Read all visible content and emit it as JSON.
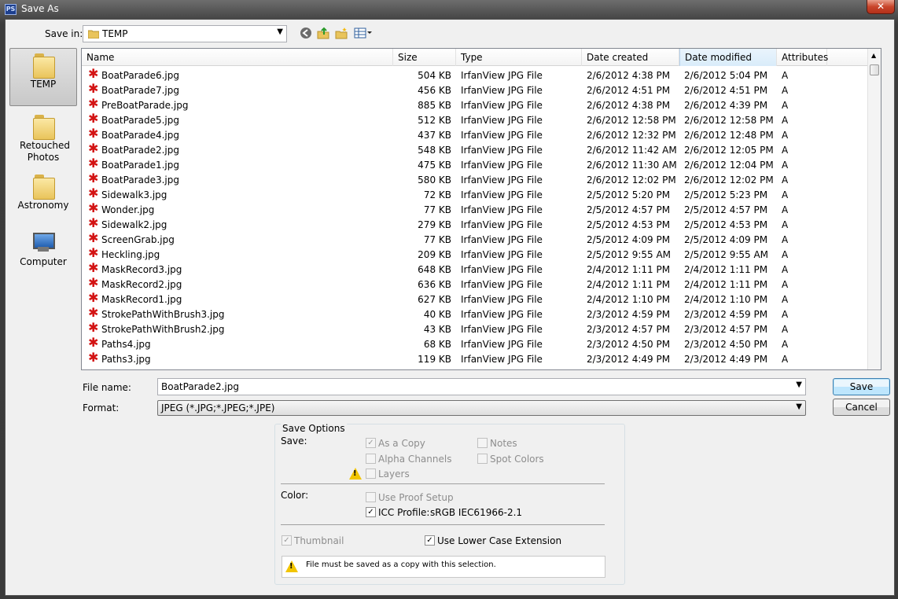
{
  "window": {
    "title": "Save As",
    "app_icon": "PS",
    "close_glyph": "✕"
  },
  "savein": {
    "label": "Save in:",
    "value": "TEMP"
  },
  "toolbar": {
    "back": "◄",
    "up": "↑",
    "new_folder": "✦",
    "views": "▦▾"
  },
  "places": [
    {
      "label": "TEMP",
      "icon": "folder-icon",
      "selected": true
    },
    {
      "label": "Retouched Photos",
      "icon": "folder-icon"
    },
    {
      "label": "Astronomy",
      "icon": "folder-icon"
    },
    {
      "label": "Computer",
      "icon": "computer-icon"
    }
  ],
  "columns": [
    "Name",
    "Size",
    "Type",
    "Date created",
    "Date modified",
    "Attributes"
  ],
  "files": [
    {
      "name": "BoatParade6.jpg",
      "size": "504 KB",
      "type": "IrfanView JPG File",
      "created": "2/6/2012 4:38 PM",
      "modified": "2/6/2012 5:04 PM",
      "attr": "A"
    },
    {
      "name": "BoatParade7.jpg",
      "size": "456 KB",
      "type": "IrfanView JPG File",
      "created": "2/6/2012 4:51 PM",
      "modified": "2/6/2012 4:51 PM",
      "attr": "A"
    },
    {
      "name": "PreBoatParade.jpg",
      "size": "885 KB",
      "type": "IrfanView JPG File",
      "created": "2/6/2012 4:38 PM",
      "modified": "2/6/2012 4:39 PM",
      "attr": "A"
    },
    {
      "name": "BoatParade5.jpg",
      "size": "512 KB",
      "type": "IrfanView JPG File",
      "created": "2/6/2012 12:58 PM",
      "modified": "2/6/2012 12:58 PM",
      "attr": "A"
    },
    {
      "name": "BoatParade4.jpg",
      "size": "437 KB",
      "type": "IrfanView JPG File",
      "created": "2/6/2012 12:32 PM",
      "modified": "2/6/2012 12:48 PM",
      "attr": "A"
    },
    {
      "name": "BoatParade2.jpg",
      "size": "548 KB",
      "type": "IrfanView JPG File",
      "created": "2/6/2012 11:42 AM",
      "modified": "2/6/2012 12:05 PM",
      "attr": "A"
    },
    {
      "name": "BoatParade1.jpg",
      "size": "475 KB",
      "type": "IrfanView JPG File",
      "created": "2/6/2012 11:30 AM",
      "modified": "2/6/2012 12:04 PM",
      "attr": "A"
    },
    {
      "name": "BoatParade3.jpg",
      "size": "580 KB",
      "type": "IrfanView JPG File",
      "created": "2/6/2012 12:02 PM",
      "modified": "2/6/2012 12:02 PM",
      "attr": "A"
    },
    {
      "name": "Sidewalk3.jpg",
      "size": "72 KB",
      "type": "IrfanView JPG File",
      "created": "2/5/2012 5:20 PM",
      "modified": "2/5/2012 5:23 PM",
      "attr": "A"
    },
    {
      "name": "Wonder.jpg",
      "size": "77 KB",
      "type": "IrfanView JPG File",
      "created": "2/5/2012 4:57 PM",
      "modified": "2/5/2012 4:57 PM",
      "attr": "A"
    },
    {
      "name": "Sidewalk2.jpg",
      "size": "279 KB",
      "type": "IrfanView JPG File",
      "created": "2/5/2012 4:53 PM",
      "modified": "2/5/2012 4:53 PM",
      "attr": "A"
    },
    {
      "name": "ScreenGrab.jpg",
      "size": "77 KB",
      "type": "IrfanView JPG File",
      "created": "2/5/2012 4:09 PM",
      "modified": "2/5/2012 4:09 PM",
      "attr": "A"
    },
    {
      "name": "Heckling.jpg",
      "size": "209 KB",
      "type": "IrfanView JPG File",
      "created": "2/5/2012 9:55 AM",
      "modified": "2/5/2012 9:55 AM",
      "attr": "A"
    },
    {
      "name": "MaskRecord3.jpg",
      "size": "648 KB",
      "type": "IrfanView JPG File",
      "created": "2/4/2012 1:11 PM",
      "modified": "2/4/2012 1:11 PM",
      "attr": "A"
    },
    {
      "name": "MaskRecord2.jpg",
      "size": "636 KB",
      "type": "IrfanView JPG File",
      "created": "2/4/2012 1:11 PM",
      "modified": "2/4/2012 1:11 PM",
      "attr": "A"
    },
    {
      "name": "MaskRecord1.jpg",
      "size": "627 KB",
      "type": "IrfanView JPG File",
      "created": "2/4/2012 1:10 PM",
      "modified": "2/4/2012 1:10 PM",
      "attr": "A"
    },
    {
      "name": "StrokePathWithBrush3.jpg",
      "size": "40 KB",
      "type": "IrfanView JPG File",
      "created": "2/3/2012 4:59 PM",
      "modified": "2/3/2012 4:59 PM",
      "attr": "A"
    },
    {
      "name": "StrokePathWithBrush2.jpg",
      "size": "43 KB",
      "type": "IrfanView JPG File",
      "created": "2/3/2012 4:57 PM",
      "modified": "2/3/2012 4:57 PM",
      "attr": "A"
    },
    {
      "name": "Paths4.jpg",
      "size": "68 KB",
      "type": "IrfanView JPG File",
      "created": "2/3/2012 4:50 PM",
      "modified": "2/3/2012 4:50 PM",
      "attr": "A"
    },
    {
      "name": "Paths3.jpg",
      "size": "119 KB",
      "type": "IrfanView JPG File",
      "created": "2/3/2012 4:49 PM",
      "modified": "2/3/2012 4:49 PM",
      "attr": "A"
    }
  ],
  "filename": {
    "label": "File name:",
    "value": "BoatParade2.jpg"
  },
  "format": {
    "label": "Format:",
    "value": "JPEG (*.JPG;*.JPEG;*.JPE)"
  },
  "buttons": {
    "save": "Save",
    "cancel": "Cancel"
  },
  "save_options": {
    "title": "Save Options",
    "save_label": "Save:",
    "as_a_copy": {
      "label": "As a Copy",
      "checked": true,
      "disabled": true
    },
    "notes": {
      "label": "Notes",
      "checked": false,
      "disabled": true
    },
    "alpha_channels": {
      "label": "Alpha Channels",
      "checked": false,
      "disabled": true
    },
    "spot_colors": {
      "label": "Spot Colors",
      "checked": false,
      "disabled": true
    },
    "layers": {
      "label": "Layers",
      "checked": false,
      "disabled": true
    },
    "color_label": "Color:",
    "use_proof_setup": {
      "label": "Use Proof Setup",
      "checked": false,
      "disabled": true
    },
    "icc_profile": {
      "label": "ICC Profile:",
      "value": "sRGB IEC61966-2.1",
      "checked": true
    },
    "thumbnail": {
      "label": "Thumbnail",
      "checked": true,
      "disabled": true
    },
    "lower_case_ext": {
      "label": "Use Lower Case Extension",
      "checked": true
    },
    "warning": "File must be saved as a copy with this selection."
  },
  "colors": {
    "title_bar": "#3c3c3c",
    "dialog_bg": "#f0f0f0",
    "accent": "#3c7fb1",
    "file_icon": "#d31414",
    "warning": "#f2c500"
  }
}
